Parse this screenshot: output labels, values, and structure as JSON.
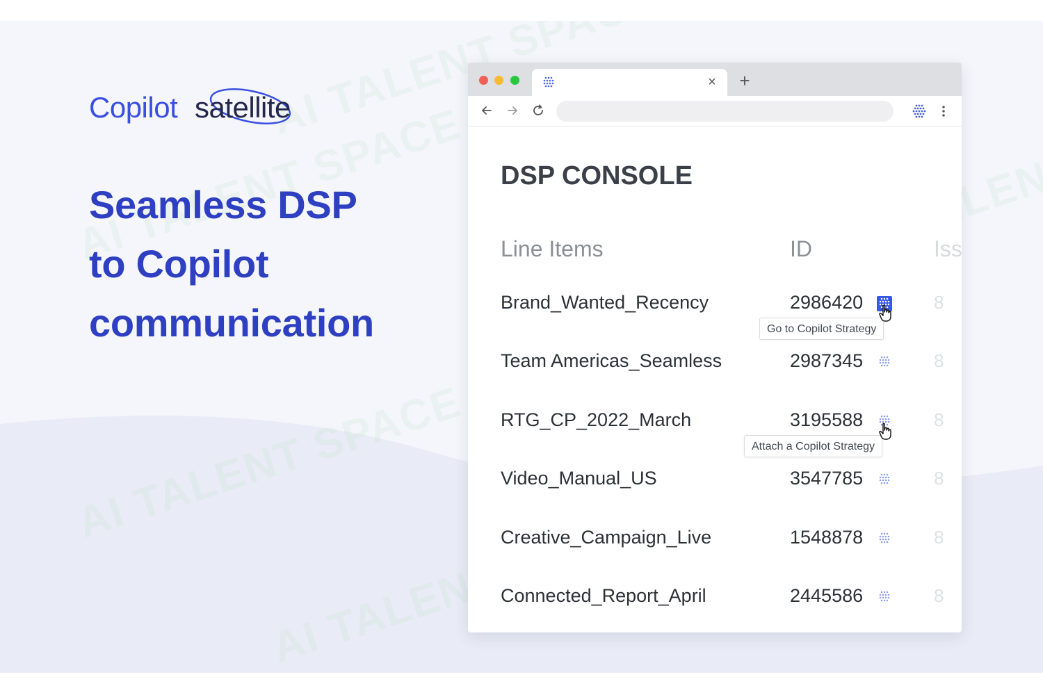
{
  "logo": {
    "word1": "Copilot",
    "word2": "satellite"
  },
  "headline": {
    "line1": "Seamless DSP",
    "line2": "to Copilot",
    "line3": "communication"
  },
  "browser": {
    "tab": {
      "close_glyph": "×"
    },
    "new_tab_glyph": "+"
  },
  "page": {
    "title": "DSP CONSOLE",
    "columns": {
      "line_items": "Line Items",
      "id": "ID",
      "iss": "Iss"
    },
    "rows": [
      {
        "name": "Brand_Wanted_Recency",
        "id": "2986420",
        "iss": "8",
        "icon_state": "active"
      },
      {
        "name": "Team Americas_Seamless",
        "id": "2987345",
        "iss": "8",
        "icon_state": "inactive"
      },
      {
        "name": "RTG_CP_2022_March",
        "id": "3195588",
        "iss": "8",
        "icon_state": "inactive"
      },
      {
        "name": "Video_Manual_US",
        "id": "3547785",
        "iss": "8",
        "icon_state": "inactive"
      },
      {
        "name": "Creative_Campaign_Live",
        "id": "1548878",
        "iss": "8",
        "icon_state": "inactive"
      },
      {
        "name": "Connected_Report_April",
        "id": "2445586",
        "iss": "8",
        "icon_state": "inactive"
      }
    ],
    "tooltips": {
      "go_to": "Go to Copilot Strategy",
      "attach": "Attach a Copilot Strategy"
    }
  },
  "watermark_text": "AI TALENT SPACE",
  "colors": {
    "brand_blue": "#3a4fe0",
    "headline_blue": "#2e3fc2",
    "icon_active": "#3a56e8",
    "background": "#f4f6fb"
  },
  "icons": [
    "copilot-hex-icon",
    "close-icon",
    "plus-icon",
    "back-arrow-icon",
    "forward-arrow-icon",
    "reload-icon",
    "kebab-menu-icon",
    "hand-cursor-icon"
  ]
}
